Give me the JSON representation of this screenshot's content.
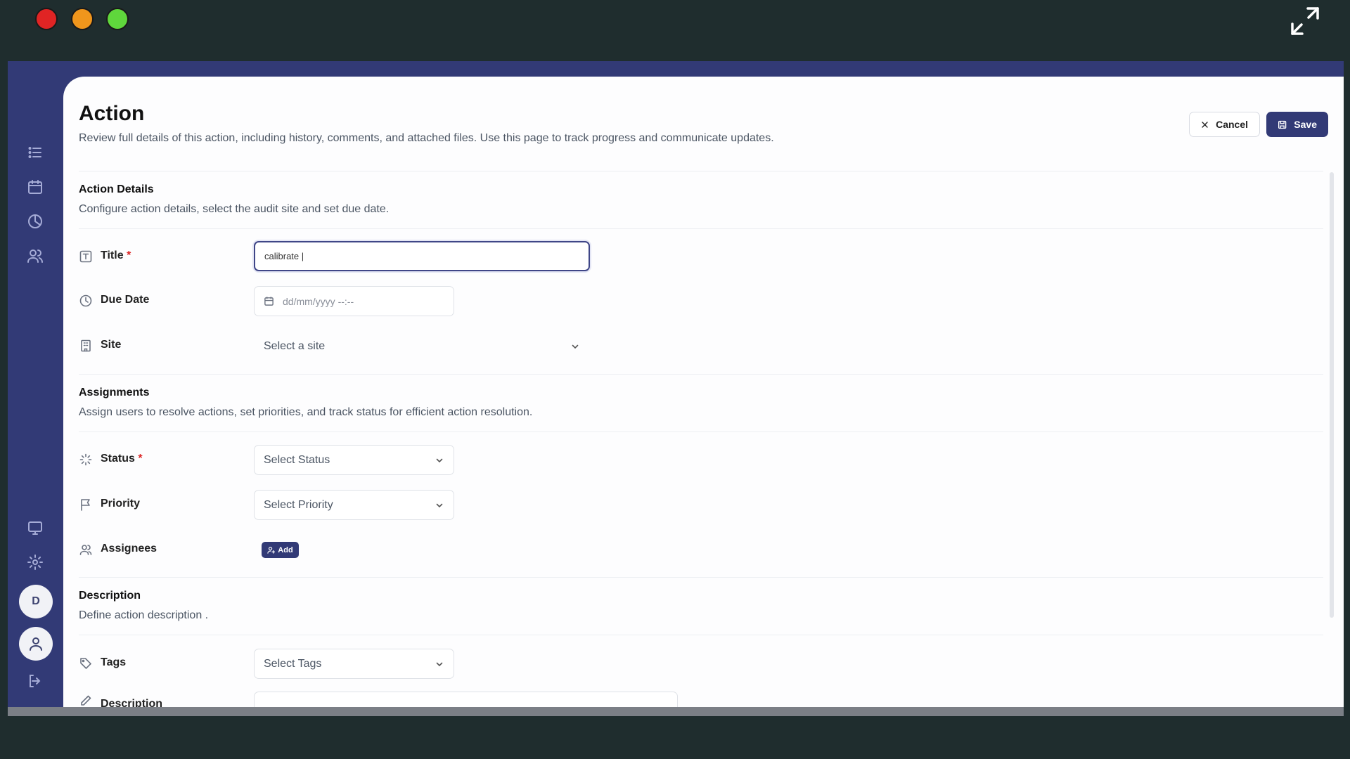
{
  "page": {
    "title": "Action",
    "subtitle": "Review full details of this action, including history, comments, and attached files. Use this page to track progress and communicate updates.",
    "cancel_label": "Cancel",
    "save_label": "Save"
  },
  "colors": {
    "brand": "#323a76",
    "required": "#dc2626"
  },
  "sidebar": {
    "top_icons": [
      "list-icon",
      "calendar-icon",
      "chart-pie-icon",
      "users-icon"
    ],
    "bottom_icons": [
      "monitor-icon",
      "gear-icon"
    ],
    "avatar_initial": "D",
    "logout_icon": "logout-icon"
  },
  "sections": {
    "details": {
      "title": "Action Details",
      "subtitle": "Configure action details, select the audit site and set due date."
    },
    "assignments": {
      "title": "Assignments",
      "subtitle": "Assign users to resolve actions, set priorities, and track status for efficient action resolution."
    },
    "description": {
      "title": "Description",
      "subtitle": "Define action description ."
    }
  },
  "fields": {
    "title": {
      "label": "Title",
      "required": "*",
      "value": "calibrate |"
    },
    "due_date": {
      "label": "Due Date",
      "placeholder": "dd/mm/yyyy --:--"
    },
    "site": {
      "label": "Site",
      "placeholder": "Select a site"
    },
    "status": {
      "label": "Status",
      "required": "*",
      "placeholder": "Select Status"
    },
    "priority": {
      "label": "Priority",
      "placeholder": "Select Priority"
    },
    "assignees": {
      "label": "Assignees",
      "add_label": "Add"
    },
    "tags": {
      "label": "Tags",
      "placeholder": "Select Tags"
    },
    "description": {
      "label": "Description"
    }
  }
}
